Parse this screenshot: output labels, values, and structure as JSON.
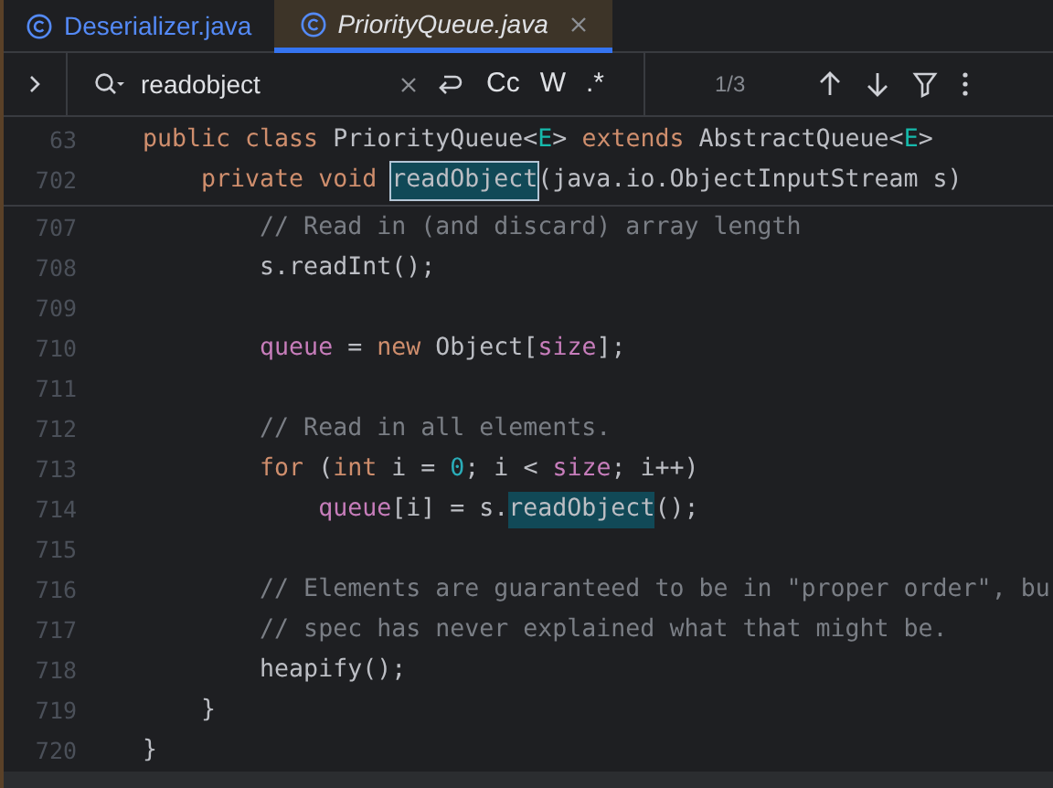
{
  "tabs": [
    {
      "label": "Deserializer.java",
      "selected": false,
      "preview": false
    },
    {
      "label": "PriorityQueue.java",
      "selected": true,
      "preview": true
    }
  ],
  "find_bar": {
    "query": "readobject",
    "options": [
      "Cc",
      "W",
      ".*"
    ],
    "match_count": "1/3"
  },
  "sticky_lines": [
    {
      "number": "63",
      "tokens": [
        {
          "kind": "keyword",
          "text": "public class "
        },
        {
          "kind": "plain",
          "text": "PriorityQueue<"
        },
        {
          "kind": "type_param",
          "text": "E"
        },
        {
          "kind": "plain",
          "text": "> "
        },
        {
          "kind": "keyword",
          "text": "extends "
        },
        {
          "kind": "plain",
          "text": "AbstractQueue<"
        },
        {
          "kind": "type_param",
          "text": "E"
        },
        {
          "kind": "plain",
          "text": ">"
        }
      ]
    },
    {
      "number": "702",
      "tokens": [
        {
          "kind": "keyword",
          "text": "    private void "
        },
        {
          "kind": "match_current",
          "text": "readObject"
        },
        {
          "kind": "plain",
          "text": "(java.io.ObjectInputStream s)"
        }
      ]
    }
  ],
  "lines": [
    {
      "number": "707",
      "tokens": [
        {
          "kind": "comment",
          "text": "        // Read in (and discard) array length"
        }
      ]
    },
    {
      "number": "708",
      "tokens": [
        {
          "kind": "plain",
          "text": "        s.readInt();"
        }
      ]
    },
    {
      "number": "709"
    },
    {
      "number": "710",
      "tokens": [
        {
          "kind": "field",
          "text": "        queue"
        },
        {
          "kind": "plain",
          "text": " = "
        },
        {
          "kind": "keyword",
          "text": "new "
        },
        {
          "kind": "plain",
          "text": "Object["
        },
        {
          "kind": "field",
          "text": "size"
        },
        {
          "kind": "plain",
          "text": "];"
        }
      ]
    },
    {
      "number": "711"
    },
    {
      "number": "712",
      "tokens": [
        {
          "kind": "comment",
          "text": "        // Read in all elements."
        }
      ]
    },
    {
      "number": "713",
      "tokens": [
        {
          "kind": "keyword",
          "text": "        for "
        },
        {
          "kind": "plain",
          "text": "("
        },
        {
          "kind": "keyword",
          "text": "int "
        },
        {
          "kind": "plain",
          "text": "i = "
        },
        {
          "kind": "number",
          "text": "0"
        },
        {
          "kind": "plain",
          "text": "; i < "
        },
        {
          "kind": "field",
          "text": "size"
        },
        {
          "kind": "plain",
          "text": "; i++)"
        }
      ]
    },
    {
      "number": "714",
      "tokens": [
        {
          "kind": "field",
          "text": "            queue"
        },
        {
          "kind": "plain",
          "text": "[i] = s."
        },
        {
          "kind": "match",
          "text": "readObject"
        },
        {
          "kind": "plain",
          "text": "();"
        }
      ]
    },
    {
      "number": "715"
    },
    {
      "number": "716",
      "tokens": [
        {
          "kind": "comment",
          "text": "        // Elements are guaranteed to be in \"proper order\", bu"
        }
      ]
    },
    {
      "number": "717",
      "tokens": [
        {
          "kind": "comment",
          "text": "        // spec has never explained what that might be."
        }
      ]
    },
    {
      "number": "718",
      "tokens": [
        {
          "kind": "plain",
          "text": "        heapify();"
        }
      ]
    },
    {
      "number": "719",
      "tokens": [
        {
          "kind": "plain",
          "text": "    }"
        }
      ]
    },
    {
      "number": "720",
      "tokens": [
        {
          "kind": "plain",
          "text": "}"
        }
      ]
    }
  ]
}
